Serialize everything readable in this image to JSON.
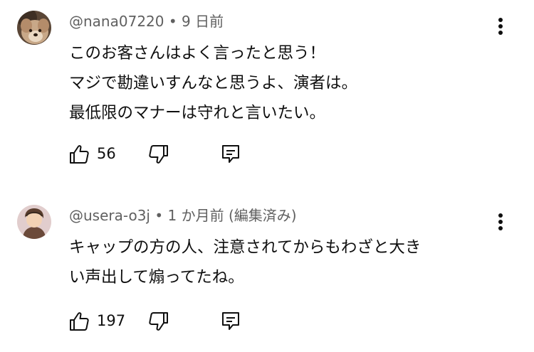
{
  "comments": [
    {
      "author": "@nana07220",
      "separator": "•",
      "time": "9 日前",
      "edited": "",
      "text": "このお客さんはよく言ったと思う！\nマジで勘違いすんなと思うよ、演者は。\n最低限のマナーは守れと言いたい。",
      "likes": "56",
      "avatar_icon": "avatar-dog-icon"
    },
    {
      "author": "@usera-o3j",
      "separator": "•",
      "time": "1 か月前",
      "edited": "(編集済み)",
      "text": "キャップの方の人、注意されてからもわざと大き\nい声出して煽ってたね。",
      "likes": "197",
      "avatar_icon": "avatar-person-icon"
    }
  ],
  "icons": {
    "like": "thumbs-up-icon",
    "dislike": "thumbs-down-icon",
    "reply": "reply-icon",
    "menu": "more-vertical-icon"
  },
  "colors": {
    "meta_text": "#606060",
    "body_text": "#0f0f0f",
    "background": "#ffffff"
  }
}
